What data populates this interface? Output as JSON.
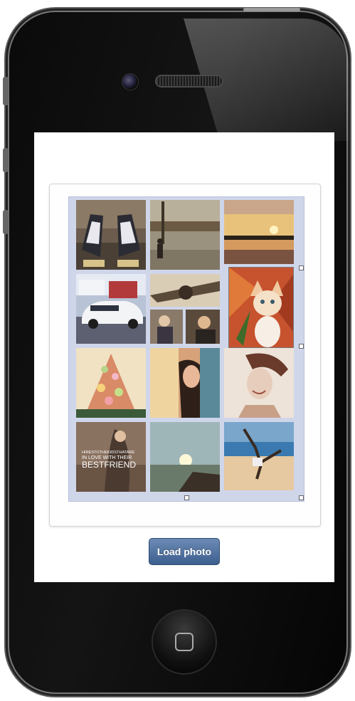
{
  "app": {
    "load_button_label": "Load photo"
  },
  "collage": {
    "photo_overlay_text": [
      "HIRESTOTHEKIDSTHATARE",
      "IN LOVE WITH THEIR",
      "BESTFRIEND"
    ]
  },
  "colors": {
    "button": "#4a6a99",
    "collage_bg": "#cfd6ea",
    "phone_body": "#0b0b0b"
  }
}
